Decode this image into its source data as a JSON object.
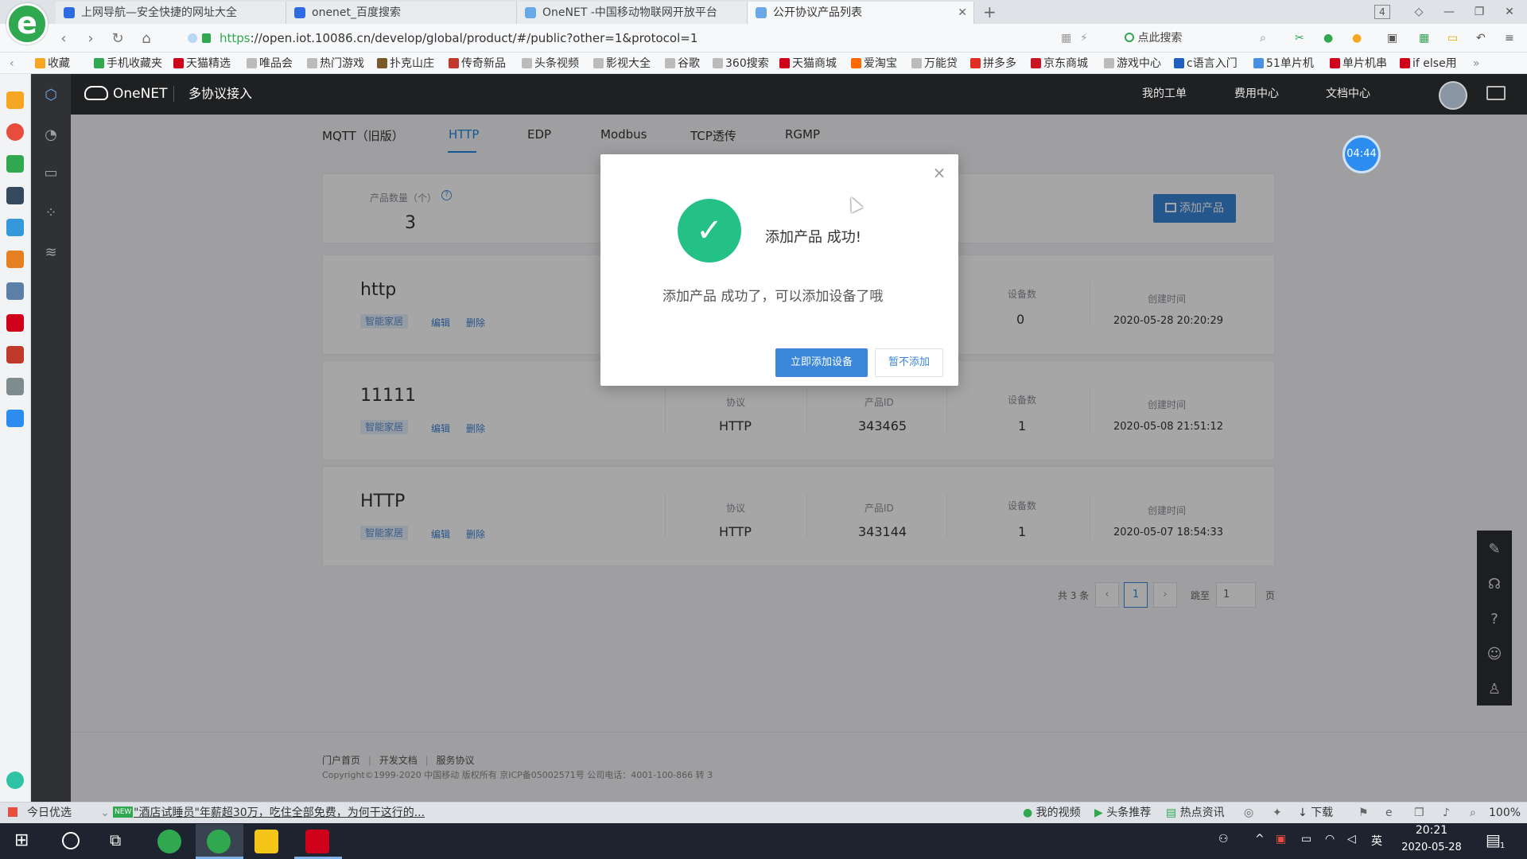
{
  "browser": {
    "tabs": [
      {
        "label": "上网导航—安全快捷的网址大全",
        "active": false
      },
      {
        "label": "onenet_百度搜索",
        "active": false
      },
      {
        "label": "OneNET -中国移动物联网开放平台",
        "active": false
      },
      {
        "label": "公开协议产品列表",
        "active": true
      }
    ],
    "tab_count_badge": "4",
    "url_scheme": "https",
    "url_rest": "://open.iot.10086.cn/develop/global/product/#/public?other=1&protocol=1",
    "search_label": "点此搜索",
    "bookmarks": [
      {
        "label": "收藏",
        "color": "#f5a623"
      },
      {
        "label": "手机收藏夹",
        "color": "#2fa84f"
      },
      {
        "label": "天猫精选",
        "color": "#d0021b"
      },
      {
        "label": "唯品会",
        "color": "#9b9b9b"
      },
      {
        "label": "热门游戏",
        "color": "#9b9b9b"
      },
      {
        "label": "扑克山庄",
        "color": "#7b5a2a"
      },
      {
        "label": "传奇新品",
        "color": "#c0392b"
      },
      {
        "label": "头条视频",
        "color": "#9b9b9b"
      },
      {
        "label": "影视大全",
        "color": "#9b9b9b"
      },
      {
        "label": "谷歌",
        "color": "#9b9b9b"
      },
      {
        "label": "360搜索",
        "color": "#9b9b9b"
      },
      {
        "label": "天猫商城",
        "color": "#d0021b"
      },
      {
        "label": "爱淘宝",
        "color": "#ff6a00"
      },
      {
        "label": "万能贷",
        "color": "#9b9b9b"
      },
      {
        "label": "拼多多",
        "color": "#e02e24"
      },
      {
        "label": "京东商城",
        "color": "#c91623"
      },
      {
        "label": "游戏中心",
        "color": "#9b9b9b"
      },
      {
        "label": "c语言入门",
        "color": "#1f5fbf"
      },
      {
        "label": "51单片机",
        "color": "#4a90e2"
      },
      {
        "label": "单片机串",
        "color": "#d0021b"
      },
      {
        "label": "if else用",
        "color": "#d0021b"
      }
    ],
    "sidebar_icon_colors": [
      "#f5a623",
      "#e74c3c",
      "#2fa84f",
      "#34495e",
      "#3498db",
      "#e67e22",
      "#e74c3c",
      "#d0021b",
      "#c0392b",
      "#7f8c8d",
      "#2d8cf0"
    ]
  },
  "app": {
    "brand": "OneNET",
    "section_title": "多协议接入",
    "top_nav": [
      "我的工单",
      "费用中心",
      "文档中心"
    ],
    "protocol_tabs": [
      {
        "label": "MQTT（旧版）",
        "active": false
      },
      {
        "label": "HTTP",
        "active": true
      },
      {
        "label": "EDP",
        "active": false
      },
      {
        "label": "Modbus",
        "active": false
      },
      {
        "label": "TCP透传",
        "active": false
      },
      {
        "label": "RGMP",
        "active": false
      }
    ],
    "summary": {
      "label": "产品数量（个）",
      "count": "3",
      "help_icon": "?"
    },
    "add_product_label": "添加产品",
    "column_labels": {
      "protocol": "协议",
      "product_id": "产品ID",
      "device_count": "设备数",
      "created": "创建时间"
    },
    "products": [
      {
        "name": "http",
        "tag": "智能家居",
        "edit": "编辑",
        "delete": "删除",
        "protocol": "",
        "product_id": "",
        "device_count": "0",
        "created": "2020-05-28 20:20:29"
      },
      {
        "name": "11111",
        "tag": "智能家居",
        "edit": "编辑",
        "delete": "删除",
        "protocol": "HTTP",
        "product_id": "343465",
        "device_count": "1",
        "created": "2020-05-08 21:51:12"
      },
      {
        "name": "HTTP",
        "tag": "智能家居",
        "edit": "编辑",
        "delete": "删除",
        "protocol": "HTTP",
        "product_id": "343144",
        "device_count": "1",
        "created": "2020-05-07 18:54:33"
      }
    ],
    "pagination": {
      "total": "共 3 条",
      "prev": "‹",
      "current": "1",
      "next": "›",
      "jump_label": "跳至",
      "jump_value": "1",
      "page_suffix": "页"
    },
    "footer": {
      "links": [
        "门户首页",
        "开发文档",
        "服务协议"
      ],
      "copyright": "Copyright©1999-2020 中国移动 版权所有 京ICP备05002571号 公司电话：4001-100-866 转 3"
    },
    "timer": "04:44"
  },
  "modal": {
    "title": "添加产品 成功!",
    "message": "添加产品 成功了，可以添加设备了哦",
    "primary_button": "立即添加设备",
    "secondary_button": "暂不添加",
    "close": "×",
    "check": "✓"
  },
  "statusbar": {
    "left_label": "今日优选",
    "new_badge": "NEW",
    "headline": "\"酒店试睡员\"年薪超30万，吃住全部免费，为何干这行的...",
    "right_items": [
      "我的视频",
      "头条推荐",
      "热点资讯"
    ],
    "download": "下载",
    "zoom": "100%"
  },
  "taskbar": {
    "ime": "英",
    "time": "20:21",
    "date": "2020-05-28",
    "notification_count": "1"
  }
}
